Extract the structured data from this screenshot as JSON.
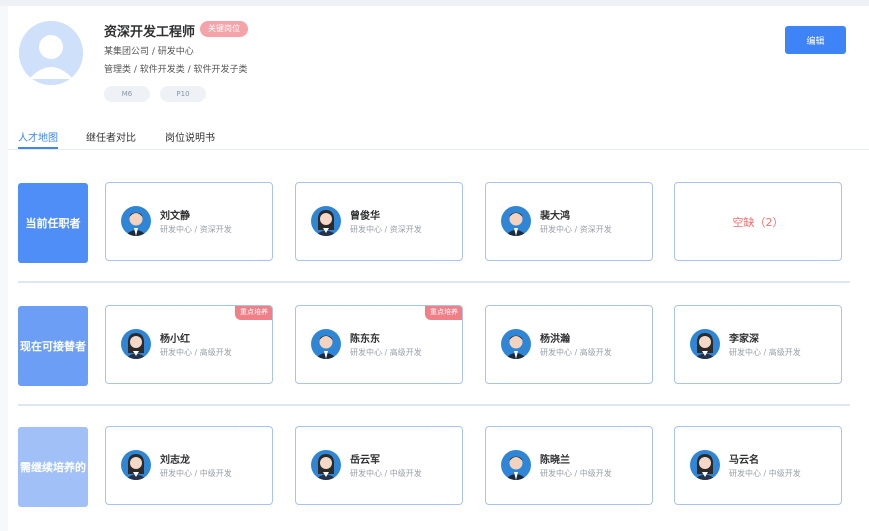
{
  "header": {
    "job_title": "资深开发工程师",
    "badge": "关键岗位",
    "org": "某集团公司 / 研发中心",
    "category": "管理类 / 软件开发类 / 软件开发子类",
    "levels": [
      "M6",
      "P10"
    ],
    "edit_label": "编辑"
  },
  "tabs": [
    {
      "label": "人才地图",
      "active": true
    },
    {
      "label": "继任者对比",
      "active": false
    },
    {
      "label": "岗位说明书",
      "active": false
    }
  ],
  "rows": [
    {
      "label": "当前任职者",
      "color": "#4f8ef7",
      "cards": [
        {
          "name": "刘文静",
          "dept": "研发中心 / 资深开发",
          "gender": "male",
          "tag": ""
        },
        {
          "name": "曾俊华",
          "dept": "研发中心 / 资深开发",
          "gender": "female",
          "tag": ""
        },
        {
          "name": "裴大鸿",
          "dept": "研发中心 / 资深开发",
          "gender": "male",
          "tag": ""
        }
      ],
      "vacant": "空缺（2）"
    },
    {
      "label": "现在可接替者",
      "color": "#6c9ef6",
      "cards": [
        {
          "name": "杨小红",
          "dept": "研发中心 / 高级开发",
          "gender": "female",
          "tag": "重点培养"
        },
        {
          "name": "陈东东",
          "dept": "研发中心 / 高级开发",
          "gender": "male",
          "tag": "重点培养"
        },
        {
          "name": "杨洪瀚",
          "dept": "研发中心 / 高级开发",
          "gender": "male",
          "tag": ""
        },
        {
          "name": "李家深",
          "dept": "研发中心 / 高级开发",
          "gender": "female",
          "tag": ""
        }
      ]
    },
    {
      "label": "需继续培养的",
      "color": "#a1c0f7",
      "cards": [
        {
          "name": "刘志龙",
          "dept": "研发中心 / 中级开发",
          "gender": "female",
          "tag": ""
        },
        {
          "name": "岳云军",
          "dept": "研发中心 / 中级开发",
          "gender": "female",
          "tag": ""
        },
        {
          "name": "陈晓兰",
          "dept": "研发中心 / 中级开发",
          "gender": "male",
          "tag": ""
        },
        {
          "name": "马云名",
          "dept": "研发中心 / 中级开发",
          "gender": "female",
          "tag": ""
        }
      ]
    }
  ]
}
